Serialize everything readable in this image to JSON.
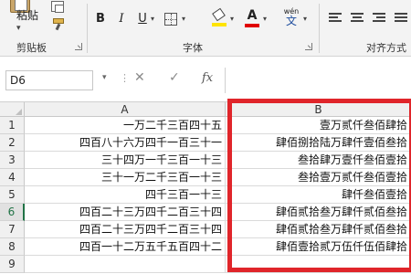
{
  "ribbon": {
    "clipboard": {
      "paste_label": "粘贴",
      "group_label": "剪贴板"
    },
    "font": {
      "bold": "B",
      "italic": "I",
      "underline": "U",
      "font_color_letter": "A",
      "phonetic_top": "wén",
      "phonetic_char": "文",
      "group_label": "字体",
      "fill_color": "#ffe400",
      "font_color": "#e00000"
    },
    "alignment": {
      "group_label": "对齐方式"
    }
  },
  "formula_bar": {
    "name_box": "D6",
    "cancel": "✕",
    "enter": "✓",
    "fx": "fx",
    "value": ""
  },
  "grid": {
    "columns": [
      "A",
      "B"
    ],
    "active_row": 6,
    "rows": [
      {
        "num": "1",
        "a": "一万二千三百四十五",
        "b": "壹万贰仟叁佰肆拾"
      },
      {
        "num": "2",
        "a": "四百八十六万四千一百三十一",
        "b": "肆佰捌拾陆万肆仟壹佰叁拾"
      },
      {
        "num": "3",
        "a": "三十四万一千三百一十三",
        "b": "叁拾肆万壹仟叁佰壹拾"
      },
      {
        "num": "4",
        "a": "三十一万二千三百一十三",
        "b": "叁拾壹万贰仟叁佰壹拾"
      },
      {
        "num": "5",
        "a": "四千三百一十三",
        "b": "肆仟叁佰壹拾"
      },
      {
        "num": "6",
        "a": "四百二十三万四千二百三十四",
        "b": "肆佰贰拾叁万肆仟贰佰叁拾"
      },
      {
        "num": "7",
        "a": "四百二十三万四千二百三十四",
        "b": "肆佰贰拾叁万肆仟贰佰叁拾"
      },
      {
        "num": "8",
        "a": "四百一十二万五千五百四十二",
        "b": "肆佰壹拾贰万伍仟伍佰肆拾"
      },
      {
        "num": "9",
        "a": "",
        "b": ""
      }
    ]
  },
  "highlight_color": "#e0252a"
}
